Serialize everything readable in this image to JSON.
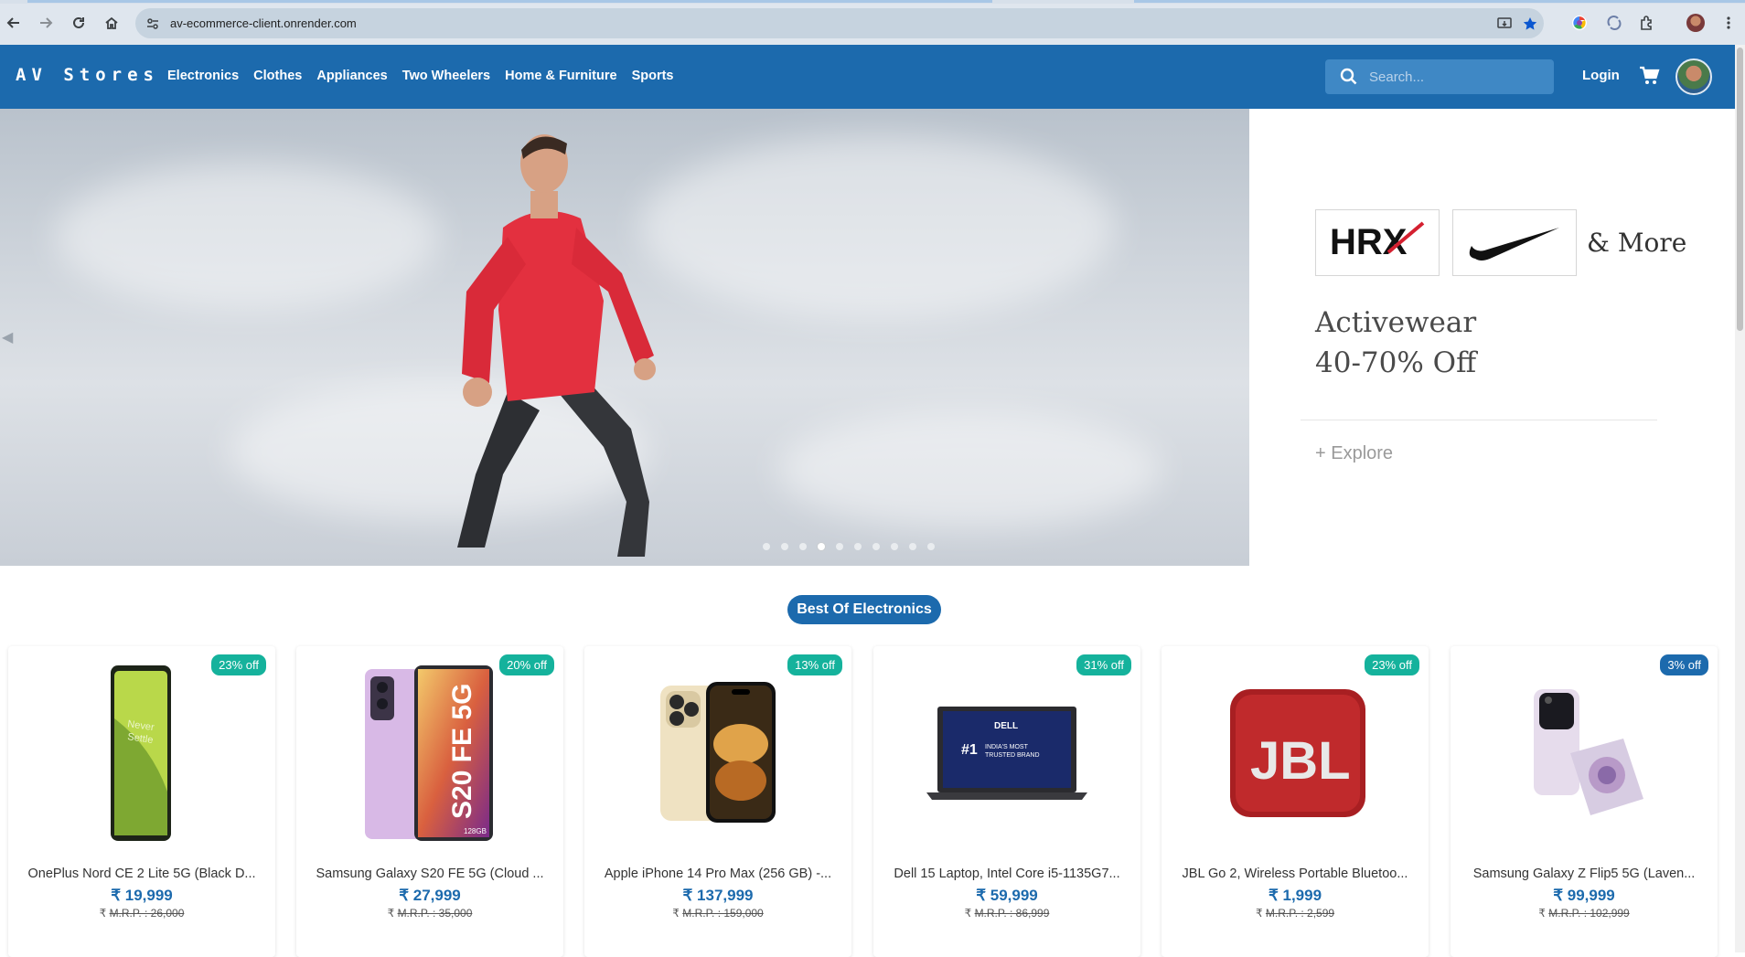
{
  "browser": {
    "url": "av-ecommerce-client.onrender.com"
  },
  "nav": {
    "brand": "AV Stores",
    "links": [
      "Electronics",
      "Clothes",
      "Appliances",
      "Two Wheelers",
      "Home & Furniture",
      "Sports"
    ],
    "search_placeholder": "Search...",
    "login": "Login"
  },
  "hero": {
    "promo": {
      "more": "& More",
      "title_line1": "Activewear",
      "title_line2": "40-70% Off",
      "explore": "+ Explore"
    },
    "slide_count": 10,
    "active_slide": 4
  },
  "section": {
    "title": "Best Of Electronics"
  },
  "products": [
    {
      "name": "OnePlus Nord CE 2 Lite 5G (Black D...",
      "price": "₹ 19,999",
      "mrp_label": "₹ ",
      "mrp": "M.R.P. : 26,000",
      "discount": "23% off",
      "badge_color": "#15b29c"
    },
    {
      "name": "Samsung Galaxy S20 FE 5G (Cloud ...",
      "price": "₹ 27,999",
      "mrp_label": "₹ ",
      "mrp": "M.R.P. : 35,000",
      "discount": "20% off",
      "badge_color": "#15b29c"
    },
    {
      "name": "Apple iPhone 14 Pro Max (256 GB) -...",
      "price": "₹ 137,999",
      "mrp_label": "₹ ",
      "mrp": "M.R.P. : 159,000",
      "discount": "13% off",
      "badge_color": "#15b29c"
    },
    {
      "name": "Dell 15 Laptop, Intel Core i5-1135G7...",
      "price": "₹ 59,999",
      "mrp_label": "₹ ",
      "mrp": "M.R.P. : 86,999",
      "discount": "31% off",
      "badge_color": "#15b29c"
    },
    {
      "name": "JBL Go 2, Wireless Portable Bluetoo...",
      "price": "₹ 1,999",
      "mrp_label": "₹ ",
      "mrp": "M.R.P. : 2,599",
      "discount": "23% off",
      "badge_color": "#15b29c"
    },
    {
      "name": "Samsung Galaxy Z Flip5 5G (Laven...",
      "price": "₹ 99,999",
      "mrp_label": "₹ ",
      "mrp": "M.R.P. : 102,999",
      "discount": "3% off",
      "badge_color": "#1c6aad"
    }
  ],
  "colors": {
    "brand_blue": "#1c6aad",
    "discount_teal": "#15b29c"
  }
}
